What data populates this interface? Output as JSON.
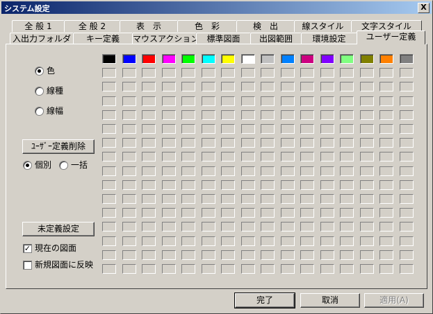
{
  "window": {
    "title": "システム設定",
    "close_label": "X"
  },
  "tabs_back_row": [
    "全 般 1",
    "全 般 2",
    "表　示",
    "色　彩",
    "検　出",
    "線スタイル",
    "文字スタイル"
  ],
  "tabs_front_row": [
    "入出力フォルダ",
    "キー定義",
    "マウスアクション",
    "標準図面",
    "出図範囲",
    "環境設定",
    "ユーザー定義"
  ],
  "selected_tab": "ユーザー定義",
  "type_group": {
    "options": [
      "色",
      "線種",
      "線幅"
    ],
    "selected": "色"
  },
  "delete_user_def_button": "ﾕｰｻﾞｰ定義削除",
  "scope_options": {
    "options": [
      "個別",
      "一括"
    ],
    "selected": "個別"
  },
  "undefined_button": "未定義設定",
  "checkboxes": [
    {
      "label": "現在の図面",
      "checked": true
    },
    {
      "label": "新規図面に反映",
      "checked": false
    }
  ],
  "color_swatches": [
    "#000000",
    "#0000ff",
    "#ff0000",
    "#ff00ff",
    "#00ff00",
    "#00ffff",
    "#ffff00",
    "#ffffff",
    "#c0c0c0",
    "#0080ff",
    "#cc0080",
    "#8000ff",
    "#80ff80",
    "#808000",
    "#ff8000",
    "#808080"
  ],
  "footer": {
    "ok": "完了",
    "cancel": "取消",
    "apply": "適用(A)"
  }
}
